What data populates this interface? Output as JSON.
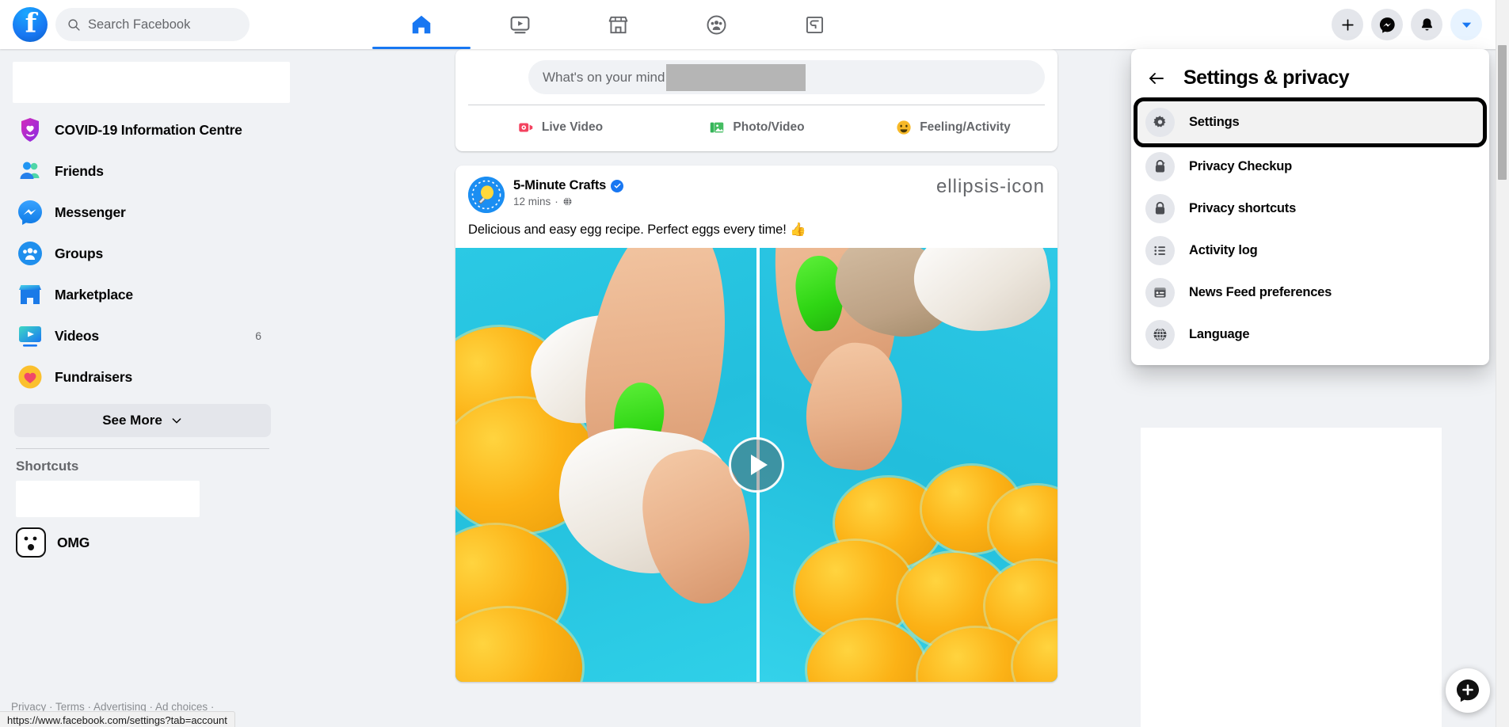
{
  "header": {
    "logo_alt": "facebook-logo",
    "search": {
      "placeholder": "Search Facebook",
      "value": ""
    },
    "nav_tabs": [
      {
        "name": "home",
        "icon": "home-icon",
        "active": true
      },
      {
        "name": "watch",
        "icon": "watch-icon",
        "active": false
      },
      {
        "name": "marketplace",
        "icon": "marketplace-icon",
        "active": false
      },
      {
        "name": "groups",
        "icon": "groups-icon",
        "active": false
      },
      {
        "name": "gaming",
        "icon": "gaming-icon",
        "active": false
      }
    ],
    "actions": [
      {
        "name": "create",
        "icon": "plus-icon",
        "active": false
      },
      {
        "name": "messenger",
        "icon": "messenger-icon",
        "active": false
      },
      {
        "name": "notifications",
        "icon": "bell-icon",
        "active": false
      },
      {
        "name": "account-menu",
        "icon": "chevron-down-icon",
        "active": true
      }
    ]
  },
  "sidebar": {
    "items": [
      {
        "label": "COVID-19 Information Centre",
        "icon": "covid-shield-icon",
        "badge": ""
      },
      {
        "label": "Friends",
        "icon": "friends-icon",
        "badge": ""
      },
      {
        "label": "Messenger",
        "icon": "messenger-icon",
        "badge": ""
      },
      {
        "label": "Groups",
        "icon": "groups-icon",
        "badge": ""
      },
      {
        "label": "Marketplace",
        "icon": "marketplace-icon",
        "badge": ""
      },
      {
        "label": "Videos",
        "icon": "videos-icon",
        "badge": "6"
      },
      {
        "label": "Fundraisers",
        "icon": "fundraisers-icon",
        "badge": ""
      }
    ],
    "see_more": "See More",
    "shortcuts_title": "Shortcuts",
    "shortcuts": [
      {
        "label": "OMG",
        "icon": "omg-face-icon"
      }
    ],
    "footer": "Privacy · Terms · Advertising · Ad choices  · "
  },
  "composer": {
    "placeholder": "What's on your mind",
    "actions": [
      {
        "label": "Live Video",
        "icon": "live-video-icon"
      },
      {
        "label": "Photo/Video",
        "icon": "photo-video-icon"
      },
      {
        "label": "Feeling/Activity",
        "icon": "feeling-activity-icon"
      }
    ]
  },
  "post": {
    "author": "5-Minute Crafts",
    "verified": true,
    "timestamp": "12 mins",
    "audience_icon": "globe-icon",
    "separator": "·",
    "more_icon": "ellipsis-icon",
    "text": "Delicious and easy egg recipe. Perfect eggs every time! 👍",
    "media_type": "video",
    "play_icon": "play-icon"
  },
  "dropdown": {
    "back_icon": "arrow-left-icon",
    "title": "Settings & privacy",
    "items": [
      {
        "label": "Settings",
        "icon": "gear-icon",
        "highlighted": true
      },
      {
        "label": "Privacy Checkup",
        "icon": "lock-check-icon",
        "highlighted": false
      },
      {
        "label": "Privacy shortcuts",
        "icon": "lock-icon",
        "highlighted": false
      },
      {
        "label": "Activity log",
        "icon": "list-icon",
        "highlighted": false
      },
      {
        "label": "News Feed preferences",
        "icon": "news-feed-icon",
        "highlighted": false
      },
      {
        "label": "Language",
        "icon": "globe-icon",
        "highlighted": false
      }
    ]
  },
  "right_column": {
    "new_message_icon": "new-message-icon"
  },
  "status_bar": {
    "url": "https://www.facebook.com/settings?tab=account"
  },
  "colors": {
    "brand_blue": "#1877f2",
    "page_bg": "#f0f2f5",
    "card_bg": "#ffffff",
    "text_primary": "#050505",
    "text_secondary": "#65676b",
    "highlight_outline": "#000000"
  }
}
